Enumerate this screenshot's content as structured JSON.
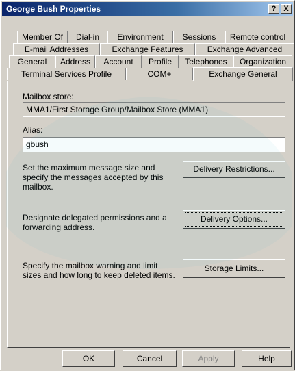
{
  "window": {
    "title": "George Bush Properties",
    "help_button": "?",
    "close_button": "X"
  },
  "tabs": {
    "row1": [
      "Member Of",
      "Dial-in",
      "Environment",
      "Sessions",
      "Remote control"
    ],
    "row2": [
      "E-mail Addresses",
      "Exchange Features",
      "Exchange Advanced"
    ],
    "row3": [
      "General",
      "Address",
      "Account",
      "Profile",
      "Telephones",
      "Organization"
    ],
    "row4": [
      "Terminal Services Profile",
      "COM+",
      "Exchange General"
    ],
    "active": "Exchange General"
  },
  "mailbox_store": {
    "label": "Mailbox store:",
    "value": "MMA1/First Storage Group/Mailbox Store (MMA1)"
  },
  "alias": {
    "label": "Alias:",
    "value": "gbush"
  },
  "delivery_restrictions": {
    "description": "Set the maximum message size and specify the messages accepted by this mailbox.",
    "button": "Delivery Restrictions..."
  },
  "delivery_options": {
    "description": "Designate delegated permissions and a forwarding address.",
    "button": "Delivery Options..."
  },
  "storage_limits": {
    "description": "Specify the mailbox warning and limit sizes and how long to keep deleted items.",
    "button": "Storage Limits..."
  },
  "footer": {
    "ok": "OK",
    "cancel": "Cancel",
    "apply": "Apply",
    "help": "Help"
  },
  "colors": {
    "face": "#d4d0c8",
    "title_start": "#0a246a",
    "title_end": "#a6caf0",
    "watermark": "#3fb8c8"
  }
}
